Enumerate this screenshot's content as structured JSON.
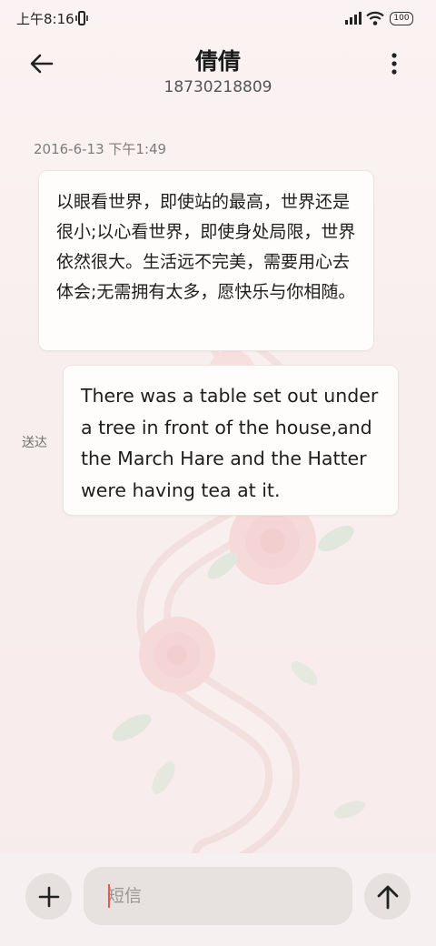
{
  "status_bar": {
    "time": "上午8:16",
    "battery": "100"
  },
  "header": {
    "contact_name": "倩倩",
    "phone_number": "18730218809"
  },
  "conversation": {
    "timestamp": "2016-6-13 下午1:49",
    "messages": [
      {
        "direction": "received",
        "text": "以眼看世界，即使站的最高，世界还是很小;以心看世界，即使身处局限，世界依然很大。生活远不完美，需要用心去体会;无需拥有太多，愿快乐与你相随。"
      },
      {
        "direction": "sent",
        "text": "There was a table set out under a tree in front of the house,and the March Hare and the Hatter were having tea at it.",
        "status": "送达"
      }
    ]
  },
  "composer": {
    "placeholder": "短信",
    "value": "",
    "add_icon": "plus-icon",
    "send_icon": "arrow-up-icon"
  },
  "colors": {
    "background": "#fbf3f3",
    "bubble": "#fffdfc",
    "accent_cursor": "#e35d4f"
  }
}
